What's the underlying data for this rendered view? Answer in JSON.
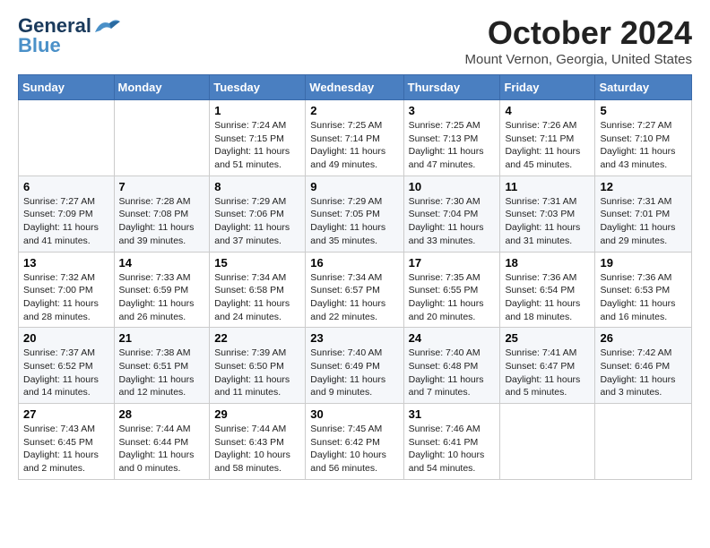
{
  "header": {
    "logo_general": "General",
    "logo_blue": "Blue",
    "month": "October 2024",
    "location": "Mount Vernon, Georgia, United States"
  },
  "weekdays": [
    "Sunday",
    "Monday",
    "Tuesday",
    "Wednesday",
    "Thursday",
    "Friday",
    "Saturday"
  ],
  "weeks": [
    [
      {
        "day": "",
        "info": ""
      },
      {
        "day": "",
        "info": ""
      },
      {
        "day": "1",
        "info": "Sunrise: 7:24 AM\nSunset: 7:15 PM\nDaylight: 11 hours and 51 minutes."
      },
      {
        "day": "2",
        "info": "Sunrise: 7:25 AM\nSunset: 7:14 PM\nDaylight: 11 hours and 49 minutes."
      },
      {
        "day": "3",
        "info": "Sunrise: 7:25 AM\nSunset: 7:13 PM\nDaylight: 11 hours and 47 minutes."
      },
      {
        "day": "4",
        "info": "Sunrise: 7:26 AM\nSunset: 7:11 PM\nDaylight: 11 hours and 45 minutes."
      },
      {
        "day": "5",
        "info": "Sunrise: 7:27 AM\nSunset: 7:10 PM\nDaylight: 11 hours and 43 minutes."
      }
    ],
    [
      {
        "day": "6",
        "info": "Sunrise: 7:27 AM\nSunset: 7:09 PM\nDaylight: 11 hours and 41 minutes."
      },
      {
        "day": "7",
        "info": "Sunrise: 7:28 AM\nSunset: 7:08 PM\nDaylight: 11 hours and 39 minutes."
      },
      {
        "day": "8",
        "info": "Sunrise: 7:29 AM\nSunset: 7:06 PM\nDaylight: 11 hours and 37 minutes."
      },
      {
        "day": "9",
        "info": "Sunrise: 7:29 AM\nSunset: 7:05 PM\nDaylight: 11 hours and 35 minutes."
      },
      {
        "day": "10",
        "info": "Sunrise: 7:30 AM\nSunset: 7:04 PM\nDaylight: 11 hours and 33 minutes."
      },
      {
        "day": "11",
        "info": "Sunrise: 7:31 AM\nSunset: 7:03 PM\nDaylight: 11 hours and 31 minutes."
      },
      {
        "day": "12",
        "info": "Sunrise: 7:31 AM\nSunset: 7:01 PM\nDaylight: 11 hours and 29 minutes."
      }
    ],
    [
      {
        "day": "13",
        "info": "Sunrise: 7:32 AM\nSunset: 7:00 PM\nDaylight: 11 hours and 28 minutes."
      },
      {
        "day": "14",
        "info": "Sunrise: 7:33 AM\nSunset: 6:59 PM\nDaylight: 11 hours and 26 minutes."
      },
      {
        "day": "15",
        "info": "Sunrise: 7:34 AM\nSunset: 6:58 PM\nDaylight: 11 hours and 24 minutes."
      },
      {
        "day": "16",
        "info": "Sunrise: 7:34 AM\nSunset: 6:57 PM\nDaylight: 11 hours and 22 minutes."
      },
      {
        "day": "17",
        "info": "Sunrise: 7:35 AM\nSunset: 6:55 PM\nDaylight: 11 hours and 20 minutes."
      },
      {
        "day": "18",
        "info": "Sunrise: 7:36 AM\nSunset: 6:54 PM\nDaylight: 11 hours and 18 minutes."
      },
      {
        "day": "19",
        "info": "Sunrise: 7:36 AM\nSunset: 6:53 PM\nDaylight: 11 hours and 16 minutes."
      }
    ],
    [
      {
        "day": "20",
        "info": "Sunrise: 7:37 AM\nSunset: 6:52 PM\nDaylight: 11 hours and 14 minutes."
      },
      {
        "day": "21",
        "info": "Sunrise: 7:38 AM\nSunset: 6:51 PM\nDaylight: 11 hours and 12 minutes."
      },
      {
        "day": "22",
        "info": "Sunrise: 7:39 AM\nSunset: 6:50 PM\nDaylight: 11 hours and 11 minutes."
      },
      {
        "day": "23",
        "info": "Sunrise: 7:40 AM\nSunset: 6:49 PM\nDaylight: 11 hours and 9 minutes."
      },
      {
        "day": "24",
        "info": "Sunrise: 7:40 AM\nSunset: 6:48 PM\nDaylight: 11 hours and 7 minutes."
      },
      {
        "day": "25",
        "info": "Sunrise: 7:41 AM\nSunset: 6:47 PM\nDaylight: 11 hours and 5 minutes."
      },
      {
        "day": "26",
        "info": "Sunrise: 7:42 AM\nSunset: 6:46 PM\nDaylight: 11 hours and 3 minutes."
      }
    ],
    [
      {
        "day": "27",
        "info": "Sunrise: 7:43 AM\nSunset: 6:45 PM\nDaylight: 11 hours and 2 minutes."
      },
      {
        "day": "28",
        "info": "Sunrise: 7:44 AM\nSunset: 6:44 PM\nDaylight: 11 hours and 0 minutes."
      },
      {
        "day": "29",
        "info": "Sunrise: 7:44 AM\nSunset: 6:43 PM\nDaylight: 10 hours and 58 minutes."
      },
      {
        "day": "30",
        "info": "Sunrise: 7:45 AM\nSunset: 6:42 PM\nDaylight: 10 hours and 56 minutes."
      },
      {
        "day": "31",
        "info": "Sunrise: 7:46 AM\nSunset: 6:41 PM\nDaylight: 10 hours and 54 minutes."
      },
      {
        "day": "",
        "info": ""
      },
      {
        "day": "",
        "info": ""
      }
    ]
  ]
}
